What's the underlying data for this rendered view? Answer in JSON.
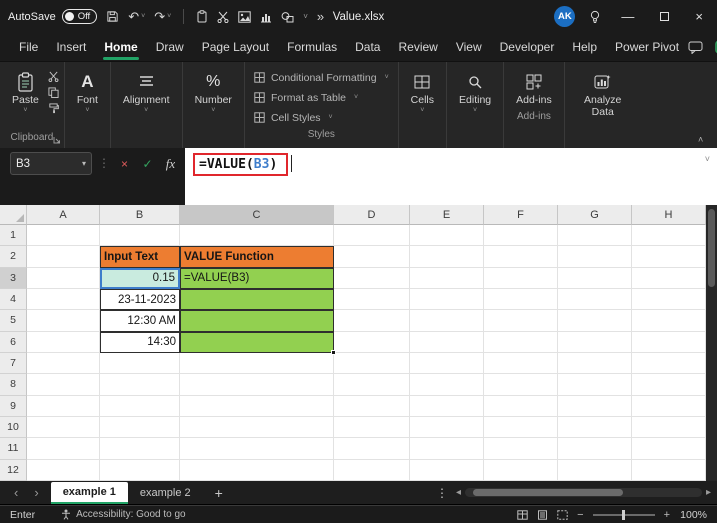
{
  "colors": {
    "accent_green": "#21A366",
    "header_fill": "#ED7D31",
    "value_fill": "#92D050",
    "ref_fill": "#C9EBDF",
    "ref_border": "#3E7DCB",
    "annotation_red": "#E0262C",
    "avatar_blue": "#1B6EC2"
  },
  "titlebar": {
    "autosave_label": "AutoSave",
    "autosave_state": "Off",
    "filename": "Value.xlsx",
    "avatar_initials": "AK"
  },
  "menubar": {
    "items": [
      "File",
      "Insert",
      "Home",
      "Draw",
      "Page Layout",
      "Formulas",
      "Data",
      "Review",
      "View",
      "Developer",
      "Help",
      "Power Pivot"
    ],
    "active_item": "Home"
  },
  "ribbon": {
    "paste_label": "Paste",
    "font_label": "Font",
    "alignment_label": "Alignment",
    "number_label": "Number",
    "styles_items": [
      "Conditional Formatting",
      "Format as Table",
      "Cell Styles"
    ],
    "cells_label": "Cells",
    "editing_label": "Editing",
    "addins_button_label": "Add-ins",
    "analyze_label": "Analyze Data",
    "group_labels": {
      "clipboard": "Clipboard",
      "styles": "Styles",
      "addins": "Add-ins"
    }
  },
  "formula_bar": {
    "name_box_value": "B3",
    "fx_label": "fx",
    "formula_prefix": "=VALUE(",
    "formula_ref": "B3",
    "formula_suffix": ")"
  },
  "grid": {
    "column_headers": [
      "A",
      "B",
      "C",
      "D",
      "E",
      "F",
      "G",
      "H"
    ],
    "row_headers": [
      "1",
      "2",
      "3",
      "4",
      "5",
      "6",
      "7",
      "8",
      "9",
      "10",
      "11",
      "12"
    ],
    "active_column": "C",
    "active_row": "3",
    "cells": {
      "B2": "Input Text",
      "C2": "VALUE Function",
      "B3": "0.15",
      "C3": "=VALUE(B3)",
      "B4": "23-11-2023",
      "B5": "12:30 AM",
      "B6": "14:30"
    }
  },
  "sheet_tabs": {
    "tabs": [
      "example 1",
      "example 2"
    ],
    "active_tab": "example 1",
    "add_label": "+"
  },
  "status_bar": {
    "mode": "Enter",
    "accessibility_text": "Accessibility: Good to go",
    "zoom_level": "100%"
  }
}
